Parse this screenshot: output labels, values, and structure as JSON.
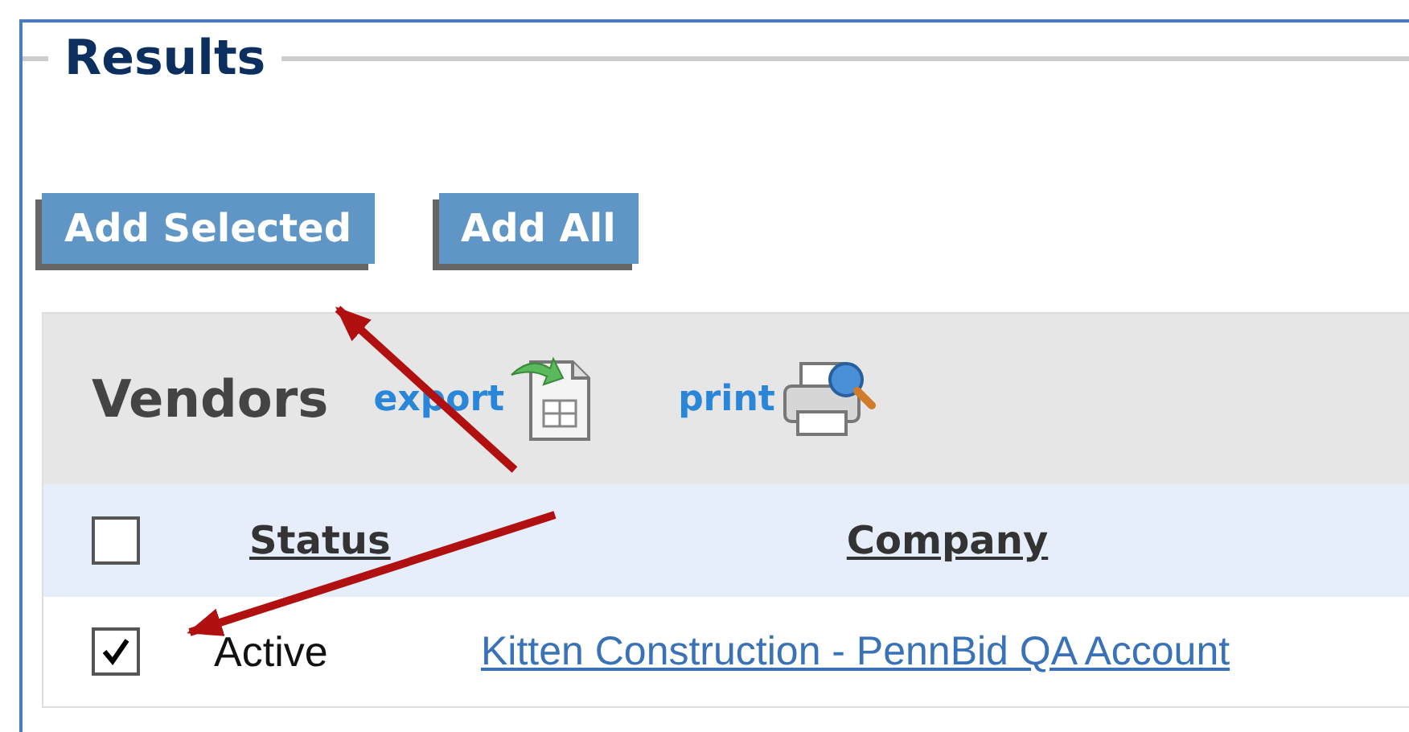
{
  "section": {
    "title": "Results"
  },
  "buttons": [
    {
      "label": "Add Selected"
    },
    {
      "label": "Add All"
    }
  ],
  "panel": {
    "title": "Vendors",
    "actions": [
      {
        "label": "export",
        "kind": "export"
      },
      {
        "label": "print",
        "kind": "print"
      }
    ]
  },
  "table": {
    "select_all": {
      "checked": false
    },
    "columns": [
      "Status",
      "Company"
    ],
    "rows": [
      {
        "checked": true,
        "status": "Active",
        "company": "Kitten Construction - PennBid QA Account"
      }
    ]
  }
}
